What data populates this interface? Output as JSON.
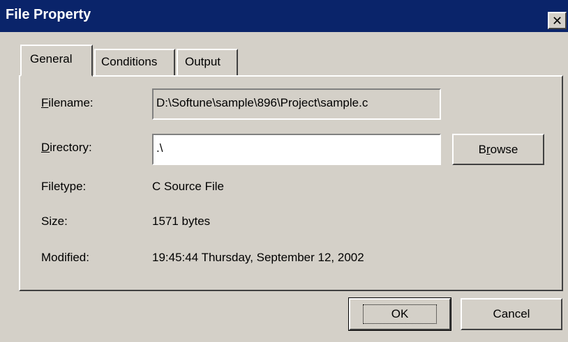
{
  "window": {
    "title": "File Property",
    "close_glyph": "✕"
  },
  "tabs": [
    {
      "label": "General",
      "active": true
    },
    {
      "label": "Conditions",
      "active": false
    },
    {
      "label": "Output",
      "active": false
    }
  ],
  "general": {
    "filename_label_accel": "F",
    "filename_label_rest": "ilename:",
    "filename_value": "D:\\Softune\\sample\\896\\Project\\sample.c",
    "directory_label_accel": "D",
    "directory_label_rest": "irectory:",
    "directory_value": ".\\",
    "browse_pre": "B",
    "browse_accel": "r",
    "browse_post": "owse",
    "filetype_label": "Filetype:",
    "filetype_value": "C Source File",
    "size_label": "Size:",
    "size_value": "1571 bytes",
    "modified_label": "Modified:",
    "modified_value": "19:45:44 Thursday, September 12, 2002"
  },
  "buttons": {
    "ok": "OK",
    "cancel": "Cancel"
  },
  "colors": {
    "titlebar": "#0a246a",
    "face": "#d4d0c8"
  }
}
